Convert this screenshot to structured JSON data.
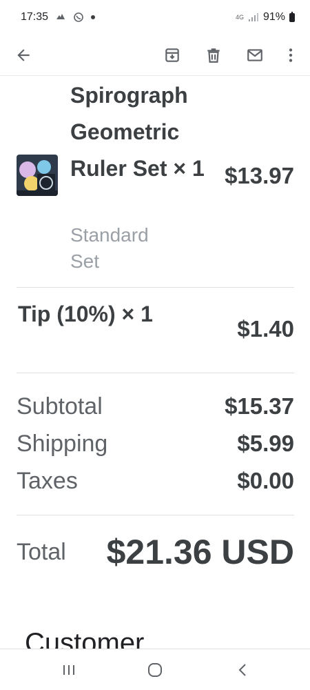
{
  "status_bar": {
    "time": "17:35",
    "network": "4G",
    "battery": "91%"
  },
  "toolbar": {
    "back_icon": "arrow-left-icon",
    "archive_icon": "archive-icon",
    "delete_icon": "trash-icon",
    "mail_icon": "envelope-icon",
    "more_icon": "more-vert-icon"
  },
  "order": {
    "item": {
      "title": "Spirograph Geometric Ruler Set × 1",
      "variant": "Standard Set",
      "price": "$13.97"
    },
    "tip": {
      "label": "Tip (10%) × 1",
      "price": "$1.40"
    },
    "summary": [
      {
        "label": "Subtotal",
        "value": "$15.37"
      },
      {
        "label": "Shipping",
        "value": "$5.99"
      },
      {
        "label": "Taxes",
        "value": "$0.00"
      }
    ],
    "total": {
      "label": "Total",
      "value": "$21.36 USD"
    },
    "next_section_heading": "Customer"
  },
  "colors": {
    "text_primary": "#3c4043",
    "text_secondary": "#9aa0a6",
    "divider": "#e0e0e0"
  }
}
